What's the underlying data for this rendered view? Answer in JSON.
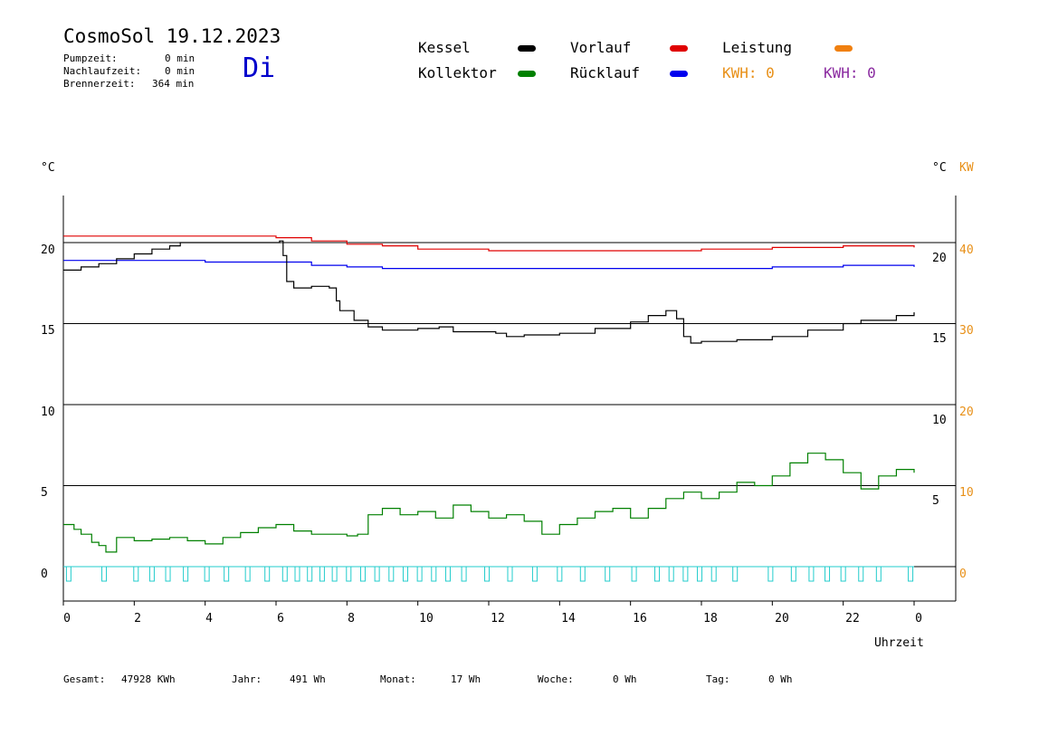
{
  "header": {
    "title": "CosmoSol 19.12.2023",
    "weekday": "Di",
    "stats": [
      {
        "label": "Pumpzeit:",
        "value": "0 min"
      },
      {
        "label": "Nachlaufzeit:",
        "value": "0 min"
      },
      {
        "label": "Brennerzeit:",
        "value": "364 min"
      }
    ]
  },
  "legend": {
    "items": [
      {
        "label": "Kessel",
        "color": "#000000"
      },
      {
        "label": "Vorlauf",
        "color": "#e00000"
      },
      {
        "label": "Leistung",
        "color": "#f08010"
      },
      {
        "label": "Kollektor",
        "color": "#008000"
      },
      {
        "label": "Rücklauf",
        "color": "#0000ee"
      }
    ],
    "kwh": [
      {
        "text": "KWH: 0",
        "color": "#e89018"
      },
      {
        "text": "KWH: 0",
        "color": "#8a2aa0"
      }
    ]
  },
  "axes": {
    "left_unit": "°C",
    "right_unit": "°C",
    "right_unit2": "KW",
    "xlabel": "Uhrzeit",
    "left_ticks": [
      "20",
      "15",
      "10",
      "5",
      "0"
    ],
    "right_ticks_temp": [
      "20",
      "15",
      "10",
      "5"
    ],
    "right_ticks_kw": [
      "40",
      "30",
      "20",
      "10",
      "0"
    ],
    "x_ticks": [
      "0",
      "2",
      "4",
      "6",
      "8",
      "10",
      "12",
      "14",
      "16",
      "18",
      "20",
      "22",
      "0"
    ]
  },
  "footer": [
    {
      "label": "Gesamt:",
      "value": "47928 KWh"
    },
    {
      "label": "Jahr:",
      "value": "491 Wh"
    },
    {
      "label": "Monat:",
      "value": "17 Wh"
    },
    {
      "label": "Woche:",
      "value": "0 Wh"
    },
    {
      "label": "Tag:",
      "value": "0 Wh"
    }
  ],
  "chart_data": {
    "type": "line",
    "x_unit": "hours",
    "xlim": [
      0,
      24
    ],
    "ylim_left": [
      0,
      20
    ],
    "ylim_right_kw": [
      0,
      40
    ],
    "series": [
      {
        "name": "Vorlauf",
        "color": "#e00000",
        "points": [
          [
            0,
            20.4
          ],
          [
            1,
            20.4
          ],
          [
            3,
            20.4
          ],
          [
            5,
            20.4
          ],
          [
            6,
            20.3
          ],
          [
            7,
            20.1
          ],
          [
            8,
            19.9
          ],
          [
            9,
            19.8
          ],
          [
            10,
            19.6
          ],
          [
            11,
            19.6
          ],
          [
            12,
            19.5
          ],
          [
            14,
            19.5
          ],
          [
            16,
            19.5
          ],
          [
            18,
            19.6
          ],
          [
            20,
            19.7
          ],
          [
            22,
            19.8
          ],
          [
            24,
            19.7
          ]
        ]
      },
      {
        "name": "Rücklauf",
        "color": "#0000ee",
        "points": [
          [
            0,
            18.9
          ],
          [
            2,
            18.9
          ],
          [
            4,
            18.8
          ],
          [
            6,
            18.8
          ],
          [
            7,
            18.6
          ],
          [
            8,
            18.5
          ],
          [
            9,
            18.4
          ],
          [
            12,
            18.4
          ],
          [
            16,
            18.4
          ],
          [
            18,
            18.4
          ],
          [
            20,
            18.5
          ],
          [
            22,
            18.6
          ],
          [
            24,
            18.5
          ]
        ]
      },
      {
        "name": "Kessel",
        "color": "#000000",
        "points": [
          [
            0,
            18.3
          ],
          [
            0.5,
            18.5
          ],
          [
            1,
            18.7
          ],
          [
            1.5,
            19.0
          ],
          [
            2,
            19.3
          ],
          [
            2.5,
            19.6
          ],
          [
            3,
            19.8
          ],
          [
            3.3,
            20.0
          ],
          [
            4,
            20.0
          ],
          [
            5,
            20.0
          ],
          [
            5.8,
            20.0
          ],
          [
            6.1,
            20.1
          ],
          [
            6.2,
            19.2
          ],
          [
            6.3,
            17.6
          ],
          [
            6.5,
            17.2
          ],
          [
            7,
            17.3
          ],
          [
            7.5,
            17.2
          ],
          [
            7.7,
            16.4
          ],
          [
            7.8,
            15.8
          ],
          [
            8.2,
            15.2
          ],
          [
            8.6,
            14.8
          ],
          [
            9,
            14.6
          ],
          [
            10,
            14.7
          ],
          [
            10.6,
            14.8
          ],
          [
            11,
            14.5
          ],
          [
            12,
            14.5
          ],
          [
            12.2,
            14.4
          ],
          [
            12.5,
            14.2
          ],
          [
            13,
            14.3
          ],
          [
            14,
            14.4
          ],
          [
            15,
            14.7
          ],
          [
            16,
            15.1
          ],
          [
            16.5,
            15.5
          ],
          [
            17,
            15.8
          ],
          [
            17.2,
            15.8
          ],
          [
            17.3,
            15.3
          ],
          [
            17.5,
            14.2
          ],
          [
            17.7,
            13.8
          ],
          [
            18,
            13.9
          ],
          [
            19,
            14.0
          ],
          [
            20,
            14.2
          ],
          [
            21,
            14.6
          ],
          [
            22,
            15.0
          ],
          [
            22.5,
            15.2
          ],
          [
            23,
            15.2
          ],
          [
            23.5,
            15.5
          ],
          [
            24,
            15.7
          ]
        ]
      },
      {
        "name": "Kollektor",
        "color": "#008000",
        "points": [
          [
            0,
            2.6
          ],
          [
            0.3,
            2.3
          ],
          [
            0.5,
            2.0
          ],
          [
            0.8,
            1.5
          ],
          [
            1,
            1.3
          ],
          [
            1.2,
            0.9
          ],
          [
            1.5,
            1.8
          ],
          [
            2,
            1.6
          ],
          [
            2.5,
            1.7
          ],
          [
            3,
            1.8
          ],
          [
            3.5,
            1.6
          ],
          [
            4,
            1.4
          ],
          [
            4.5,
            1.8
          ],
          [
            5,
            2.1
          ],
          [
            5.5,
            2.4
          ],
          [
            6,
            2.6
          ],
          [
            6.5,
            2.2
          ],
          [
            7,
            2.0
          ],
          [
            7.5,
            2.0
          ],
          [
            8,
            1.9
          ],
          [
            8.3,
            2.0
          ],
          [
            8.6,
            3.2
          ],
          [
            9,
            3.6
          ],
          [
            9.5,
            3.2
          ],
          [
            10,
            3.4
          ],
          [
            10.5,
            3.0
          ],
          [
            11,
            3.8
          ],
          [
            11.5,
            3.4
          ],
          [
            12,
            3.0
          ],
          [
            12.5,
            3.2
          ],
          [
            13,
            2.8
          ],
          [
            13.5,
            2.0
          ],
          [
            14,
            2.6
          ],
          [
            14.5,
            3.0
          ],
          [
            15,
            3.4
          ],
          [
            15.5,
            3.6
          ],
          [
            16,
            3.0
          ],
          [
            16.5,
            3.6
          ],
          [
            17,
            4.2
          ],
          [
            17.5,
            4.6
          ],
          [
            18,
            4.2
          ],
          [
            18.5,
            4.6
          ],
          [
            19,
            5.2
          ],
          [
            19.5,
            5.0
          ],
          [
            20,
            5.6
          ],
          [
            20.5,
            6.4
          ],
          [
            21,
            7.0
          ],
          [
            21.5,
            6.6
          ],
          [
            22,
            5.8
          ],
          [
            22.5,
            4.8
          ],
          [
            23,
            5.6
          ],
          [
            23.5,
            6.0
          ],
          [
            24,
            5.8
          ]
        ]
      }
    ]
  }
}
